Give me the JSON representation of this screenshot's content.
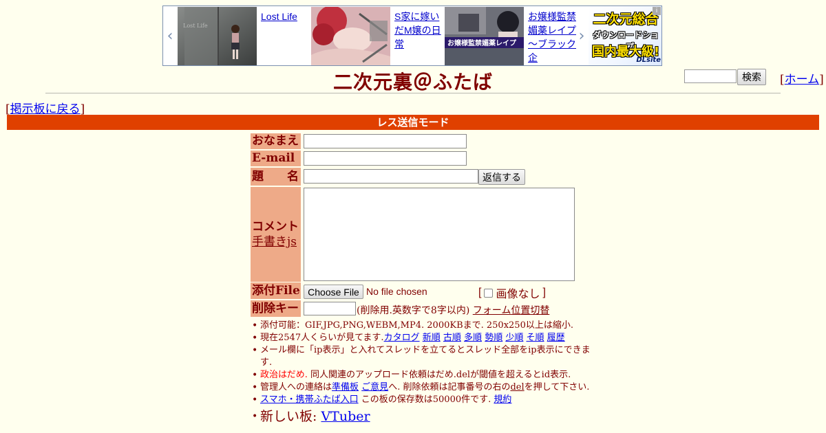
{
  "ad": {
    "items": [
      {
        "title": "Lost Life",
        "thumb_text": "Lost   Life"
      },
      {
        "title": "S家に嫁いだM嬢の日常"
      },
      {
        "title": "お嬢様監禁媚薬レイプ～ブラック企",
        "thumb_text": "お嬢様監禁媚薬レイプ"
      }
    ],
    "dlsite": {
      "line1": "二次元総合",
      "line2": "ダウンロードショップ",
      "line3": "国内最大級!",
      "logo": "DLsite"
    }
  },
  "header": {
    "title": "二次元裏＠ふたば",
    "search_button": "検索",
    "home_link": "ホーム",
    "back_link": "掲示板に戻る"
  },
  "mode_bar": "レス送信モード",
  "form": {
    "name_label": "おなまえ",
    "email_label": "E-mail",
    "subject_label": "題　　名",
    "submit_button": "返信する",
    "comment_label": "コメント",
    "handwrite_link": "手書きjs",
    "file_label": "添付File",
    "file_button": "Choose File",
    "file_status": "No file chosen",
    "no_image_label": "画像なし",
    "password_label": "削除キー",
    "password_note": "(削除用.英数字で8字以内)",
    "form_toggle_link": "フォーム位置切替"
  },
  "notes": {
    "line1": "添付可能：GIF,JPG,PNG,WEBM,MP4. 2000KBまで. 250x250以上は縮小.",
    "line2_prefix": "現在2547人くらいが見てます.",
    "sort_links": [
      "カタログ",
      "新順",
      "古順",
      "多順",
      "勢順",
      "少順",
      "そ順",
      "履歴"
    ],
    "line3": "メール欄に「ip表示」と入れてスレッドを立てるとスレッド全部をip表示にできます.",
    "line4_red": "政治はだめ.",
    "line4_rest": " 同人関連のアップロード依頼はだめ.delが閾値を超えるとid表示.",
    "line5_prefix": "管理人への連絡は",
    "line5_link1": "準備板",
    "line5_link2": "ご意見",
    "line5_mid": "へ. 削除依頼は記事番号の右の",
    "line5_del": "del",
    "line5_suffix": "を押して下さい.",
    "line6_link": "スマホ・携帯ふたば入口",
    "line6_mid": " この板の保存数は50000件です. ",
    "line6_rules": "規約",
    "line7_prefix": "新しい板: ",
    "line7_link": "VTuber"
  }
}
